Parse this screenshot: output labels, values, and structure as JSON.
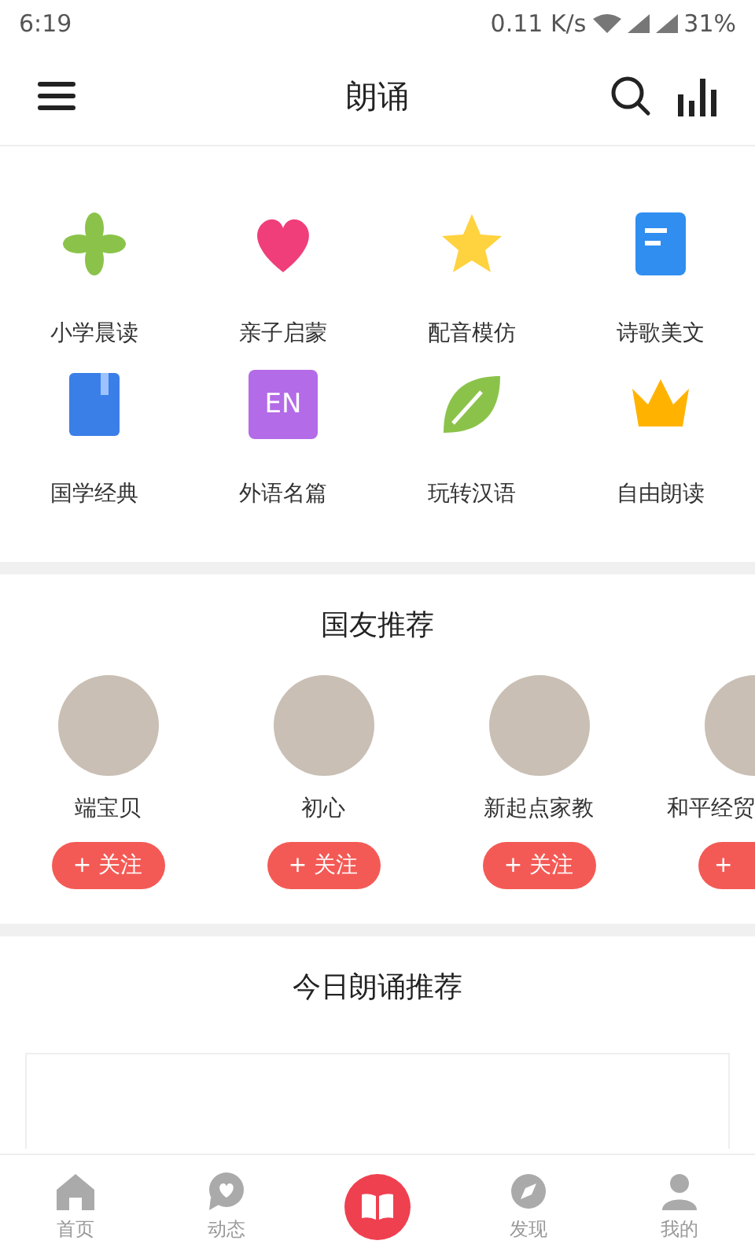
{
  "status_bar": {
    "time": "6:19",
    "speed": "0.11 K/s",
    "battery": "31%"
  },
  "top_bar": {
    "title": "朗诵"
  },
  "categories": [
    {
      "label": "小学晨读",
      "kind": "clover"
    },
    {
      "label": "亲子启蒙",
      "kind": "heart"
    },
    {
      "label": "配音模仿",
      "kind": "star"
    },
    {
      "label": "诗歌美文",
      "kind": "doc"
    },
    {
      "label": "国学经典",
      "kind": "book"
    },
    {
      "label": "外语名篇",
      "kind": "en",
      "icon_text": "EN"
    },
    {
      "label": "玩转汉语",
      "kind": "leaf"
    },
    {
      "label": "自由朗读",
      "kind": "crown"
    }
  ],
  "friends": {
    "title": "国友推荐",
    "users": [
      {
        "name": "端宝贝",
        "follow": "+ 关注"
      },
      {
        "name": "初心",
        "follow": "+ 关注"
      },
      {
        "name": "新起点家教",
        "follow": "+ 关注"
      },
      {
        "name": "和平经贸",
        "follow": "+"
      }
    ]
  },
  "today": {
    "title": "今日朗诵推荐"
  },
  "bottom_nav": [
    {
      "kind": "tab",
      "label": "首页"
    },
    {
      "kind": "tab",
      "label": "动态"
    },
    {
      "kind": "center"
    },
    {
      "kind": "tab",
      "label": "发现"
    },
    {
      "kind": "tab",
      "label": "我的"
    }
  ]
}
